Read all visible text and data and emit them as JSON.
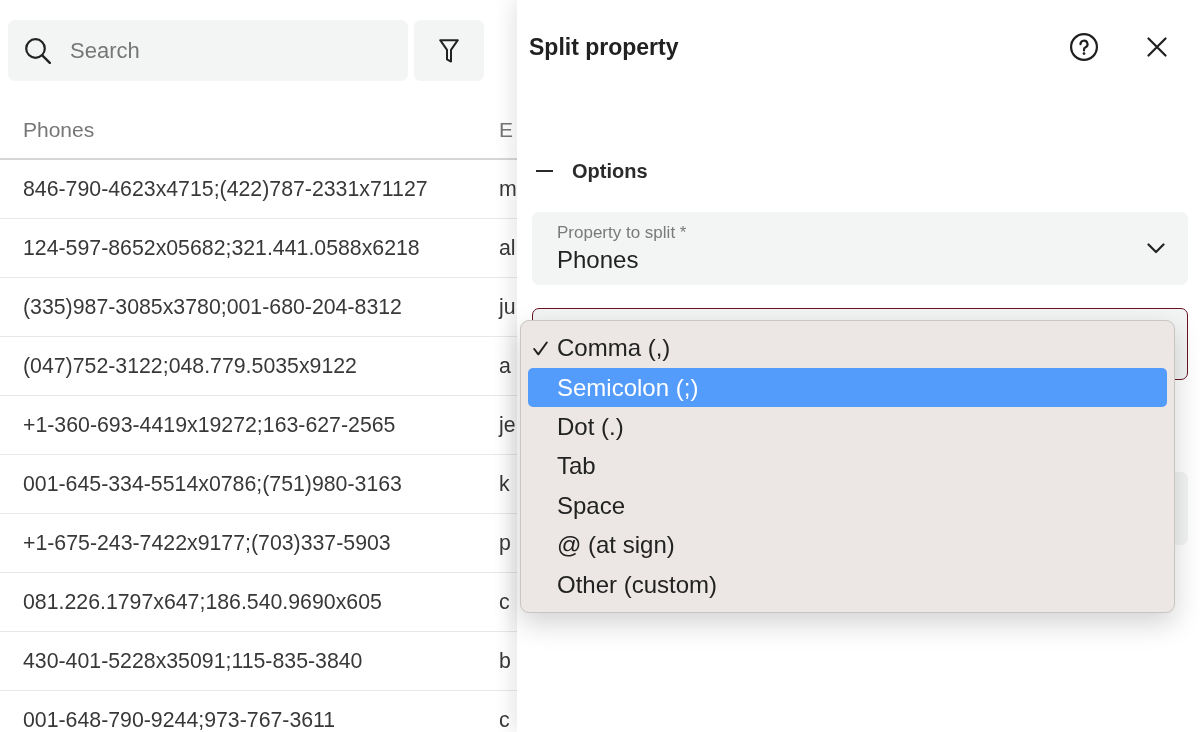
{
  "search": {
    "placeholder": "Search"
  },
  "table": {
    "columns": [
      "Phones",
      "E"
    ],
    "rows": [
      [
        "846-790-4623x4715;(422)787-2331x71127",
        "m"
      ],
      [
        "124-597-8652x05682;321.441.0588x6218",
        "al"
      ],
      [
        "(335)987-3085x3780;001-680-204-8312",
        "ju"
      ],
      [
        "(047)752-3122;048.779.5035x9122",
        "a"
      ],
      [
        "+1-360-693-4419x19272;163-627-2565",
        "je"
      ],
      [
        "001-645-334-5514x0786;(751)980-3163",
        "k"
      ],
      [
        "+1-675-243-7422x9177;(703)337-5903",
        "p"
      ],
      [
        "081.226.1797x647;186.540.9690x605",
        "c"
      ],
      [
        "430-401-5228x35091;115-835-3840",
        "b"
      ],
      [
        "001-648-790-9244;973-767-3611",
        "c"
      ]
    ]
  },
  "panel": {
    "title": "Split property",
    "section": {
      "label": "Options",
      "expanded": true
    },
    "fields": [
      {
        "kind": "select",
        "label": "Property to split *",
        "value": "Phones",
        "focused": false
      },
      {
        "kind": "blank",
        "focused": true
      },
      {
        "kind": "blank",
        "focused": false
      }
    ],
    "menu": {
      "options": [
        {
          "label": "Comma (,)",
          "checked": true,
          "highlighted": false
        },
        {
          "label": "Semicolon (;)",
          "checked": false,
          "highlighted": true
        },
        {
          "label": "Dot (.)",
          "checked": false,
          "highlighted": false
        },
        {
          "label": "Tab",
          "checked": false,
          "highlighted": false
        },
        {
          "label": "Space",
          "checked": false,
          "highlighted": false
        },
        {
          "label": "@ (at sign)",
          "checked": false,
          "highlighted": false
        },
        {
          "label": "Other (custom)",
          "checked": false,
          "highlighted": false
        }
      ]
    }
  }
}
